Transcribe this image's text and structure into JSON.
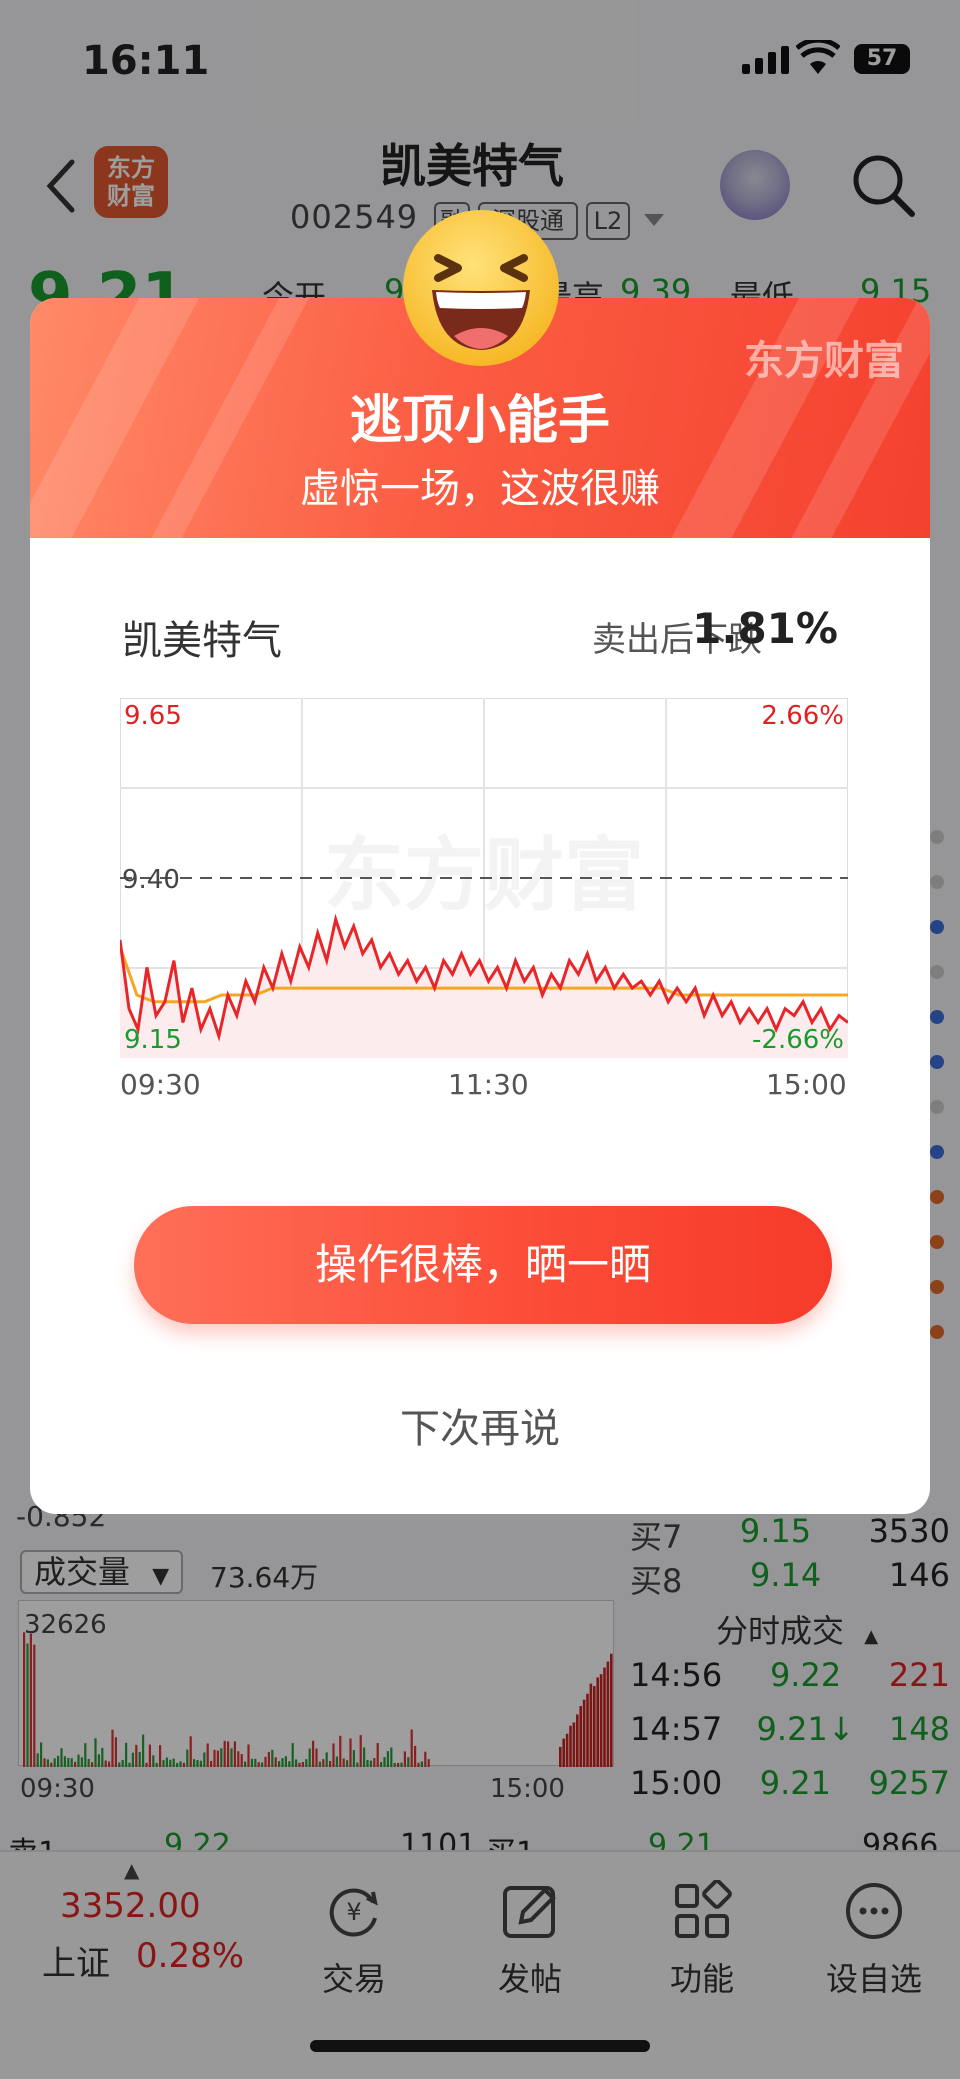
{
  "status_bar": {
    "time": "16:11",
    "battery": "57"
  },
  "header": {
    "logo_text": "东方\n财富",
    "stock_name": "凯美特气",
    "stock_code": "002549",
    "tags": [
      "融",
      "深股通",
      "L2"
    ]
  },
  "quote_row": {
    "price": "9.21",
    "items": [
      {
        "label": "今开",
        "value": "9"
      },
      {
        "label": "最高",
        "value": "9.39"
      },
      {
        "label": "最低",
        "value": "9.15"
      }
    ]
  },
  "background_chart": {
    "min_label": "-0.852"
  },
  "orderbook_right": [
    {
      "label": "买7",
      "price": "9.15",
      "volume": "3530"
    },
    {
      "label": "买8",
      "price": "9.14",
      "volume": "146"
    }
  ],
  "volume_panel": {
    "selector_label": "成交量",
    "total": "73.64万",
    "peak": "32626",
    "time_start": "09:30",
    "time_end": "15:00"
  },
  "ticks": {
    "title": "分时成交",
    "rows": [
      {
        "time": "14:56",
        "price": "9.22",
        "volume": "221"
      },
      {
        "time": "14:57",
        "price": "9.21↓",
        "volume": "148"
      },
      {
        "time": "15:00",
        "price": "9.21",
        "volume": "9257"
      }
    ]
  },
  "bottom_orderbook": {
    "sell1_label": "卖1",
    "sell1_price": "9.22",
    "sell1_vol": "1101",
    "buy1_label": "买1",
    "buy1_price": "9.21",
    "buy1_vol": "9866"
  },
  "tabbar": {
    "index_value": "3352.00",
    "index_name": "上证",
    "index_pct": "0.28%",
    "tabs": [
      {
        "label": "交易",
        "icon": "yen-refresh-icon"
      },
      {
        "label": "发帖",
        "icon": "edit-icon"
      },
      {
        "label": "功能",
        "icon": "grid-icon"
      },
      {
        "label": "设自选",
        "icon": "more-icon"
      }
    ]
  },
  "dialog": {
    "brand": "东方财富",
    "title": "逃顶小能手",
    "subtitle": "虚惊一场，这波很赚",
    "stock_name": "凯美特气",
    "drop_label": "卖出后下跌",
    "drop_value": "1.81%",
    "chart_watermark": "东方财富",
    "share_button": "操作很棒，晒一晒",
    "later_button": "下次再说"
  },
  "chart_data": {
    "type": "line",
    "title": "",
    "xlabel": "",
    "ylabel": "",
    "ylim": [
      9.15,
      9.65
    ],
    "y_tick_labels": {
      "top": "9.65",
      "mid": "9.40",
      "bottom": "9.15"
    },
    "pct_labels": {
      "top": "2.66%",
      "bottom": "-2.66%"
    },
    "x_tick_labels": [
      "09:30",
      "11:30",
      "15:00"
    ],
    "reference_line": 9.4,
    "colors": {
      "price": "#e8262a",
      "average": "#f5a623"
    },
    "series": [
      {
        "role": "price",
        "values": [
          9.31,
          9.21,
          9.18,
          9.27,
          9.2,
          9.22,
          9.28,
          9.19,
          9.24,
          9.18,
          9.21,
          9.17,
          9.23,
          9.2,
          9.25,
          9.22,
          9.27,
          9.24,
          9.29,
          9.25,
          9.3,
          9.27,
          9.32,
          9.28,
          9.34,
          9.3,
          9.33,
          9.29,
          9.31,
          9.27,
          9.29,
          9.26,
          9.28,
          9.25,
          9.27,
          9.24,
          9.28,
          9.26,
          9.29,
          9.26,
          9.28,
          9.25,
          9.27,
          9.24,
          9.28,
          9.25,
          9.27,
          9.23,
          9.26,
          9.24,
          9.28,
          9.26,
          9.29,
          9.25,
          9.27,
          9.24,
          9.26,
          9.24,
          9.25,
          9.23,
          9.25,
          9.22,
          9.24,
          9.22,
          9.24,
          9.2,
          9.23,
          9.2,
          9.22,
          9.19,
          9.21,
          9.19,
          9.21,
          9.18,
          9.21,
          9.2,
          9.22,
          9.19,
          9.21,
          9.18,
          9.2,
          9.19
        ]
      },
      {
        "role": "average",
        "values": [
          9.3,
          9.23,
          9.22,
          9.22,
          9.22,
          9.22,
          9.23,
          9.23,
          9.23,
          9.24,
          9.24,
          9.24,
          9.24,
          9.24,
          9.24,
          9.24,
          9.24,
          9.24,
          9.24,
          9.24,
          9.24,
          9.24,
          9.24,
          9.24,
          9.24,
          9.24,
          9.24,
          9.24,
          9.24,
          9.24,
          9.24,
          9.24,
          9.24,
          9.23,
          9.23,
          9.23,
          9.23,
          9.23,
          9.23,
          9.23,
          9.23,
          9.23,
          9.23,
          9.23
        ]
      }
    ]
  }
}
